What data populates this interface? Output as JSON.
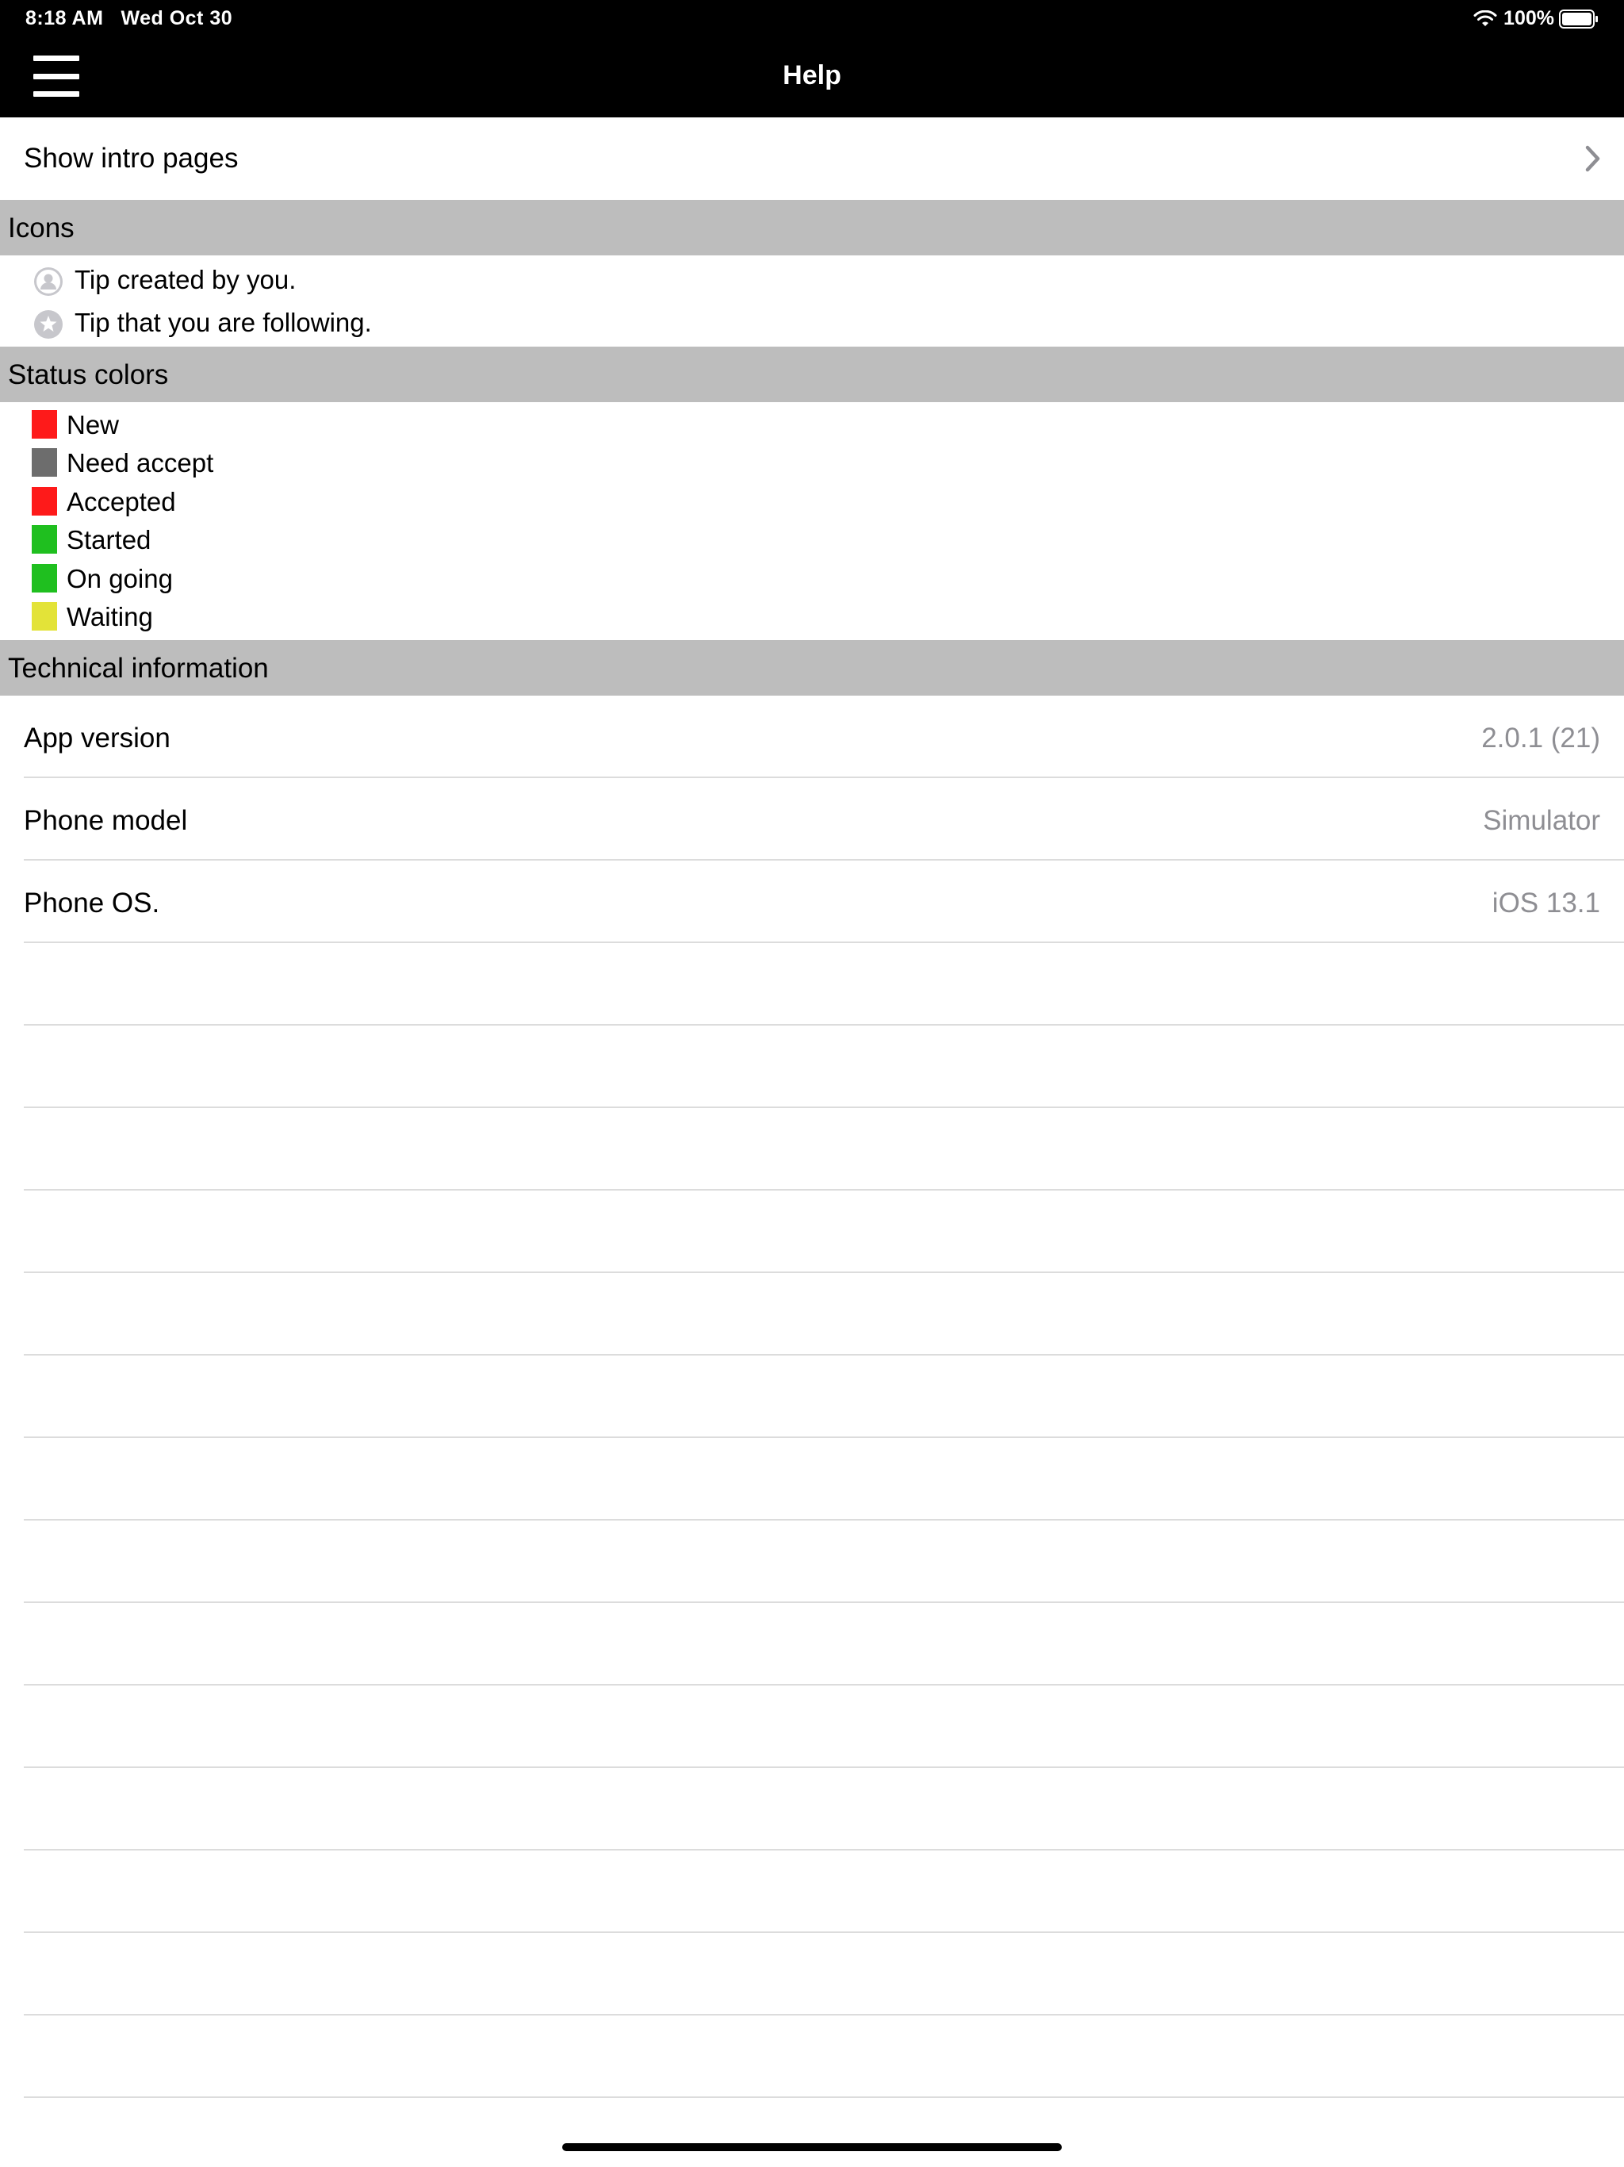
{
  "status_bar": {
    "time": "8:18 AM",
    "date": "Wed Oct 30",
    "battery": "100%",
    "icons": [
      "wifi-icon",
      "battery-icon"
    ]
  },
  "nav": {
    "title": "Help",
    "menu_icon": "hamburger-menu-icon"
  },
  "intro": {
    "label": "Show intro pages",
    "icon": "chevron-right-icon"
  },
  "icons_section": {
    "header": "Icons",
    "items": [
      {
        "icon": "user-icon",
        "label": "Tip created by you."
      },
      {
        "icon": "star-icon",
        "label": "Tip that you are following."
      }
    ]
  },
  "status_section": {
    "header": "Status colors",
    "items": [
      {
        "label": "New",
        "color": "#fe1a1a"
      },
      {
        "label": "Need accept",
        "color": "#6d6d6d"
      },
      {
        "label": "Accepted",
        "color": "#fe1a1a"
      },
      {
        "label": "Started",
        "color": "#1fbf1f"
      },
      {
        "label": "On going",
        "color": "#1fbf1f"
      },
      {
        "label": "Waiting",
        "color": "#e3e338"
      }
    ]
  },
  "tech_section": {
    "header": "Technical information",
    "rows": [
      {
        "label": "App version",
        "value": "2.0.1 (21)"
      },
      {
        "label": "Phone model",
        "value": "Simulator"
      },
      {
        "label": "Phone OS.",
        "value": "iOS 13.1"
      }
    ]
  },
  "colors": {
    "nav_background": "#000000",
    "section_header_background": "#bdbdbd",
    "value_text": "#8e8e93",
    "separator": "#dcdcdc"
  }
}
